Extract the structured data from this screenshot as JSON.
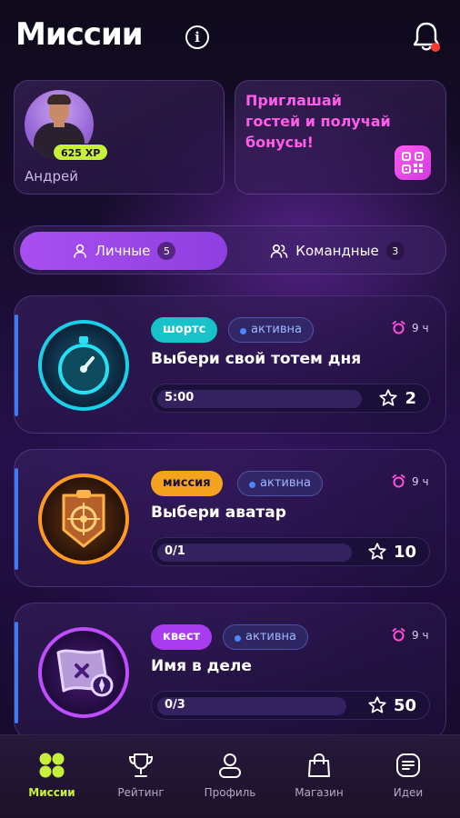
{
  "header": {
    "title": "Миссии",
    "info_icon": "info-icon",
    "bell_icon": "bell-icon"
  },
  "profile": {
    "name": "Андрей",
    "xp": "625 XP"
  },
  "invite": {
    "text": "Приглашай гостей и получай бонусы!",
    "icon": "qr-code-icon"
  },
  "tabs": [
    {
      "label": "Личные",
      "count": "5",
      "active": true,
      "icon": "user-icon"
    },
    {
      "label": "Командные",
      "count": "3",
      "active": false,
      "icon": "users-icon"
    }
  ],
  "missions": [
    {
      "tag": "шортс",
      "tag_color": "#17c2c8",
      "status": "активна",
      "timer": "9 ч",
      "title": "Выбери свой тотем дня",
      "progress": "5:00",
      "progress_fraction": 0.75,
      "reward": "2",
      "icon": "stopwatch-icon"
    },
    {
      "tag": "миссия",
      "tag_color": "#f5a31e",
      "status": "активна",
      "timer": "9 ч",
      "title": "Выбери аватар",
      "progress": "0/1",
      "progress_fraction": 0.72,
      "reward": "10",
      "icon": "target-badge-icon"
    },
    {
      "tag": "квест",
      "tag_color": "#a83df0",
      "status": "активна",
      "timer": "9 ч",
      "title": "Имя в деле",
      "progress": "0/3",
      "progress_fraction": 0.7,
      "reward": "50",
      "icon": "treasure-map-icon"
    }
  ],
  "nav": [
    {
      "label": "Миссии",
      "icon": "grid-icon",
      "active": true
    },
    {
      "label": "Рейтинг",
      "icon": "trophy-icon",
      "active": false
    },
    {
      "label": "Профиль",
      "icon": "profile-icon",
      "active": false
    },
    {
      "label": "Магазин",
      "icon": "shopping-bag-icon",
      "active": false
    },
    {
      "label": "Идеи",
      "icon": "ideas-icon",
      "active": false
    }
  ],
  "colors": {
    "accent_purple": "#a84ff0",
    "accent_lime": "#c7f03a",
    "invite_pink": "#ff5ce8",
    "status_blue": "#4b86ff"
  }
}
